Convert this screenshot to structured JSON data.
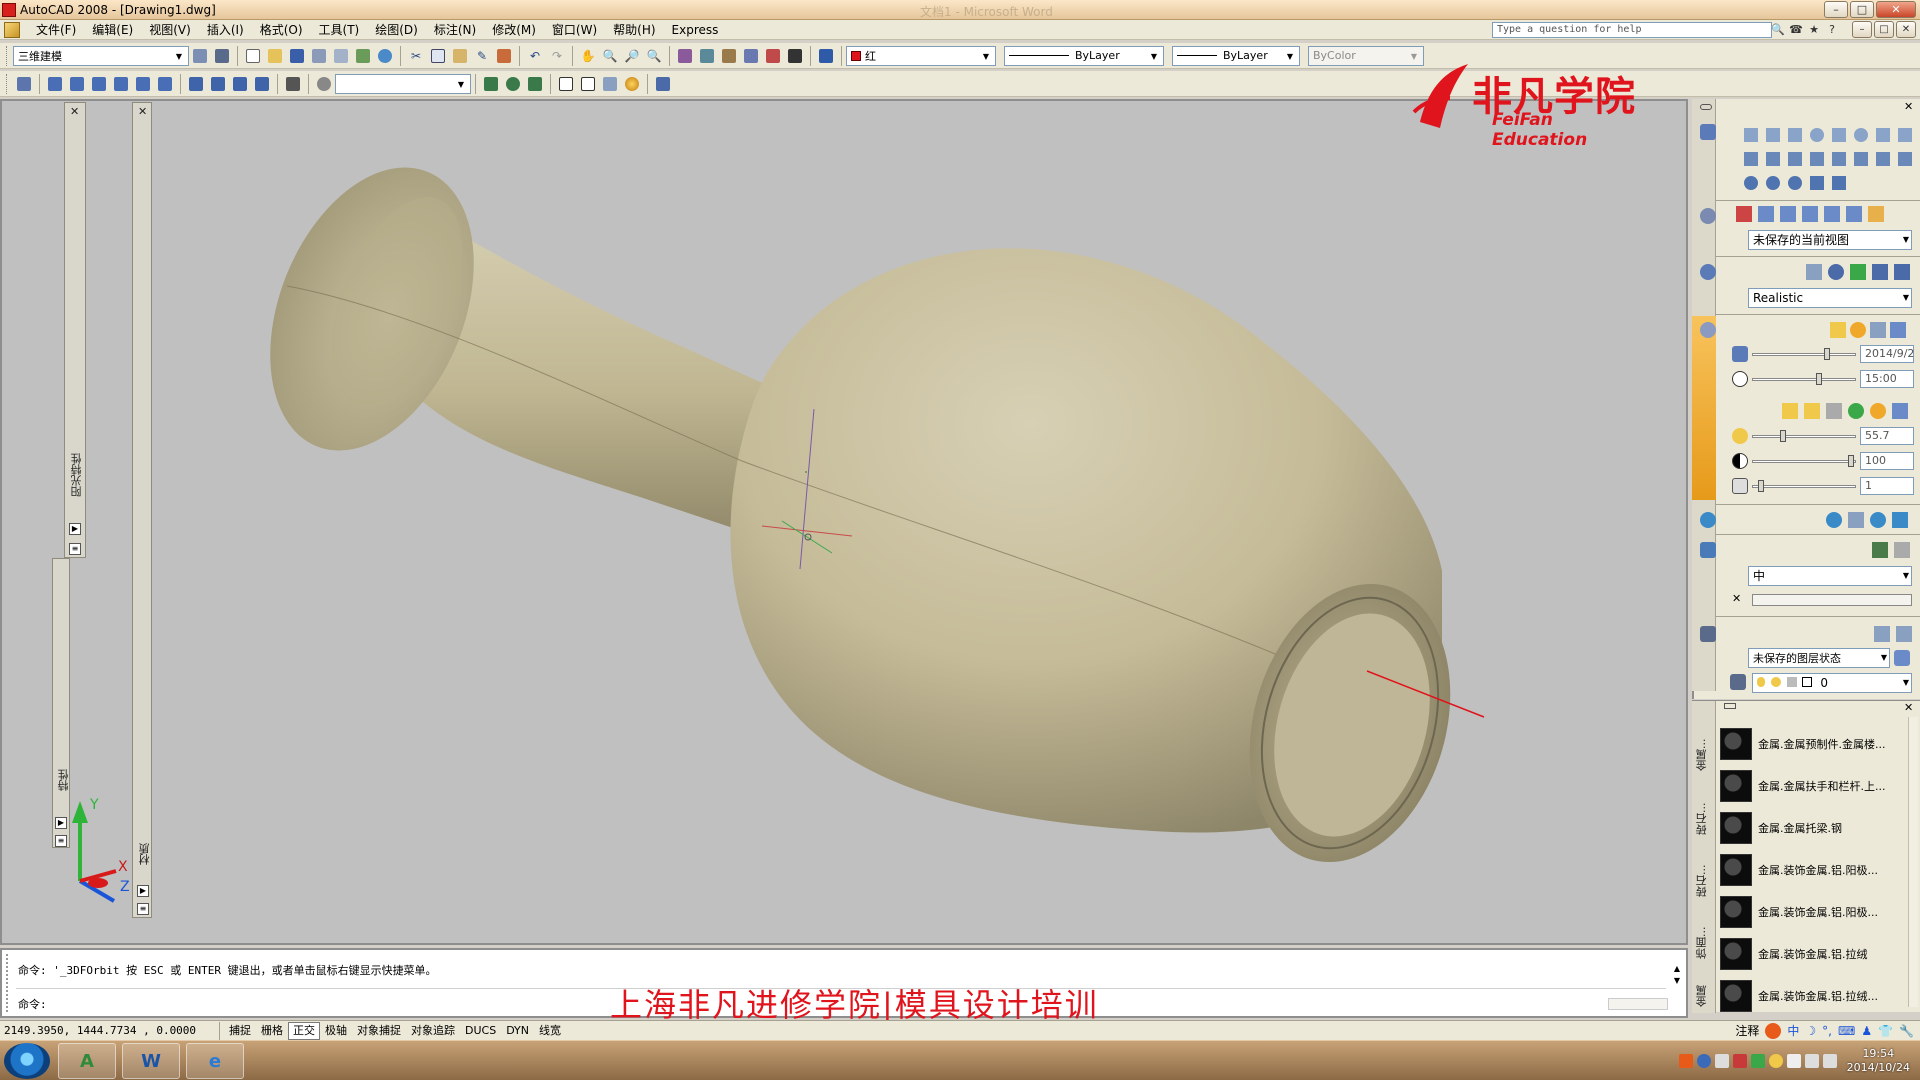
{
  "window": {
    "title": "AutoCAD 2008 - [Drawing1.dwg]",
    "ghost_title": "文档1 - Microsoft Word",
    "min_label": "–",
    "max_label": "□",
    "close_label": "✕"
  },
  "menu": {
    "items": [
      "文件(F)",
      "编辑(E)",
      "视图(V)",
      "插入(I)",
      "格式(O)",
      "工具(T)",
      "绘图(D)",
      "标注(N)",
      "修改(M)",
      "窗口(W)",
      "帮助(H)",
      "Express"
    ]
  },
  "help": {
    "placeholder": "Type a question for help"
  },
  "toolbar": {
    "workspace": "三维建模",
    "color": "红",
    "color_hex": "#e0141c",
    "linetype": "ByLayer",
    "lineweight": "ByLayer",
    "plotstyle": "ByColor"
  },
  "logo": {
    "cn": "非凡学院",
    "en": "FeiFan Education"
  },
  "left_palettes": {
    "sun_label": "阳光特性",
    "props_label": "特性",
    "mat_label": "材质"
  },
  "right_panel": {
    "view_combo": "未保存的当前视图",
    "visual_style": "Realistic",
    "date": "2014/9/2",
    "time": "15:00",
    "light_value": "55.7",
    "brightness": "100",
    "contrast": "1",
    "render_quality": "中",
    "layer_state": "未保存的图层状态",
    "layer": "0"
  },
  "tool_palette": {
    "tabs": [
      "金属...",
      "砖石...",
      "砖石...",
      "饰面...",
      "金属"
    ],
    "items": [
      "金属.金属预制件.金属楼...",
      "金属.金属扶手和栏杆.上...",
      "金属.金属托梁.钢",
      "金属.装饰金属.铝.阳极...",
      "金属.装饰金属.铝.阳极...",
      "金属.装饰金属.铝.拉绒",
      "金属.装饰金属.铝.拉绒..."
    ]
  },
  "command": {
    "history": "命令: '_3DFOrbit 按 ESC 或 ENTER 键退出，或者单击鼠标右键显示快捷菜单。",
    "prompt": "命令:"
  },
  "watermark": "上海非凡进修学院|模具设计培训",
  "status": {
    "coords": "2149.3950,  1444.7734 , 0.0000",
    "buttons": [
      {
        "label": "捕捉",
        "on": false
      },
      {
        "label": "栅格",
        "on": false
      },
      {
        "label": "正交",
        "on": true
      },
      {
        "label": "极轴",
        "on": false
      },
      {
        "label": "对象捕捉",
        "on": false
      },
      {
        "label": "对象追踪",
        "on": false
      },
      {
        "label": "DUCS",
        "on": false
      },
      {
        "label": "DYN",
        "on": false
      },
      {
        "label": "线宽",
        "on": false
      }
    ],
    "annotation": "注释",
    "ime": "中"
  },
  "taskbar": {
    "time": "19:54",
    "date": "2014/10/24"
  },
  "ucs": {
    "x_label": "X",
    "y_label": "Y",
    "z_label": "Z"
  }
}
